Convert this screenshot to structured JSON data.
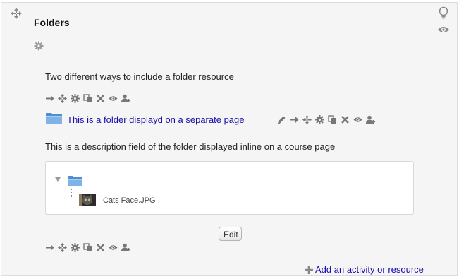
{
  "section": {
    "title": "Folders",
    "move_icon": "move-cross-icon",
    "settings_icon": "gear-icon",
    "highlight_icon": "lightbulb-icon",
    "visibility_icon": "eye-icon"
  },
  "label_text": "Two different ways to include a folder resource",
  "folder_link": "This is a folder displayd on a separate page",
  "inline_description": "This is a description field of the folder displayed inline on a course page",
  "tree": {
    "file_name": "Cats Face.JPG"
  },
  "edit_button": "Edit",
  "add_activity": "Add an activity or resource",
  "edit_icons_short": [
    "arrow-right-icon",
    "move-icon",
    "gear-icon",
    "duplicate-icon",
    "delete-icon",
    "eye-icon",
    "assign-role-icon"
  ],
  "edit_icons_long": [
    "pencil-icon",
    "arrow-right-icon",
    "move-icon",
    "gear-icon",
    "duplicate-icon",
    "delete-icon",
    "eye-icon",
    "assign-role-icon"
  ],
  "colors": {
    "link": "#1a0dab",
    "section_bg": "#f5f5f5",
    "icon": "#777777",
    "folder": "#5b9bd5"
  }
}
